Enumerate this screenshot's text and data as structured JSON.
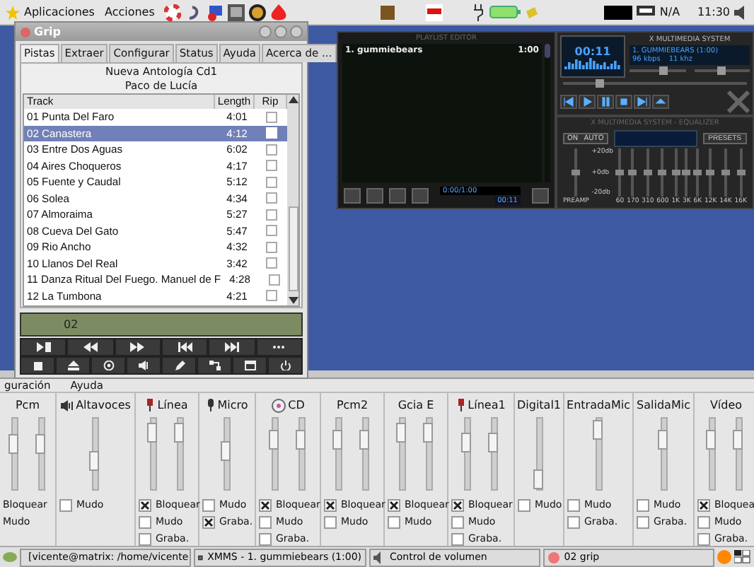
{
  "top_panel": {
    "menus": [
      "Aplicaciones",
      "Acciones"
    ],
    "status_text": "N/A",
    "clock": "11:30"
  },
  "grip": {
    "title": "Grip",
    "tabs": [
      {
        "label": "Pistas",
        "selected": true
      },
      {
        "label": "Extraer",
        "selected": false
      },
      {
        "label": "Configurar",
        "selected": false
      },
      {
        "label": "Status",
        "selected": false
      },
      {
        "label": "Ayuda",
        "selected": false
      },
      {
        "label": "Acerca de ...",
        "selected": false
      }
    ],
    "album": "Nueva Antología Cd1",
    "artist": "Paco de Lucía",
    "columns": [
      "Track",
      "Length",
      "Rip"
    ],
    "rows": [
      {
        "track": "01  Punta Del Faro",
        "length": "4:01",
        "rip": false,
        "selected": false
      },
      {
        "track": "02  Canastera",
        "length": "4:12",
        "rip": false,
        "selected": true
      },
      {
        "track": "03  Entre Dos Aguas",
        "length": "6:02",
        "rip": false,
        "selected": false
      },
      {
        "track": "04  Aires Choqueros",
        "length": "4:17",
        "rip": false,
        "selected": false
      },
      {
        "track": "05  Fuente y Caudal",
        "length": "5:12",
        "rip": false,
        "selected": false
      },
      {
        "track": "06  Solea",
        "length": "4:34",
        "rip": false,
        "selected": false
      },
      {
        "track": "07  Almoraima",
        "length": "5:27",
        "rip": false,
        "selected": false
      },
      {
        "track": "08  Cueva Del Gato",
        "length": "5:47",
        "rip": false,
        "selected": false
      },
      {
        "track": "09  Rio Ancho",
        "length": "4:32",
        "rip": false,
        "selected": false
      },
      {
        "track": "10  Llanos Del Real",
        "length": "3:42",
        "rip": false,
        "selected": false
      },
      {
        "track": "11  Danza Ritual Del Fuego. Manuel de F",
        "length": "4:28",
        "rip": false,
        "selected": false
      },
      {
        "track": "12  La Tumbona",
        "length": "4:21",
        "rip": false,
        "selected": false
      }
    ],
    "display": "02"
  },
  "xmms": {
    "playlist": {
      "title": "PLAYLIST EDITOR",
      "entries": [
        {
          "title": "1. gummiebears",
          "time": "1:00"
        }
      ],
      "time_display": "0:00/1:00",
      "counter": "00:11"
    },
    "player": {
      "title": "X MULTIMEDIA SYSTEM",
      "time": "00:11",
      "song": "1. GUMMIEBEARS (1:00)",
      "bitrate": "96 kbps",
      "rate": "11 khz",
      "volume": {
        "level": 0.6
      },
      "balance": {
        "level": 0.5
      },
      "seek": {
        "level": 0.2
      }
    },
    "equalizer": {
      "title": "X MULTIMEDIA SYSTEM - EQUALIZER",
      "on": "ON",
      "auto": "AUTO",
      "presets": "PRESETS",
      "scale": [
        "+20db",
        "+0db",
        "-20db"
      ],
      "preamp": {
        "label": "PREAMP",
        "level": 0.5
      },
      "bands": [
        {
          "label": "60",
          "level": 0.5
        },
        {
          "label": "170",
          "level": 0.5
        },
        {
          "label": "310",
          "level": 0.5
        },
        {
          "label": "600",
          "level": 0.5
        },
        {
          "label": "1K",
          "level": 0.5
        },
        {
          "label": "3K",
          "level": 0.5
        },
        {
          "label": "6K",
          "level": 0.5
        },
        {
          "label": "12K",
          "level": 0.5
        },
        {
          "label": "14K",
          "level": 0.5
        },
        {
          "label": "16K",
          "level": 0.5
        }
      ]
    }
  },
  "mixer": {
    "menus": [
      "guración",
      "Ayuda"
    ],
    "channels": [
      {
        "name": "Pcm",
        "kind": "plain",
        "sliders": [
          {
            "level": 0.65
          },
          {
            "level": 0.64
          }
        ],
        "options": [
          {
            "label": "Bloquear"
          },
          {
            "label": "Mudo"
          }
        ]
      },
      {
        "name": "Altavoces",
        "kind": "speaker",
        "sliders": [
          {
            "level": 0.4
          }
        ],
        "options": [
          {
            "label": "Mudo",
            "checked": false
          }
        ]
      },
      {
        "name": "Línea",
        "kind": "line",
        "sliders": [
          {
            "level": 0.8
          },
          {
            "level": 0.8
          }
        ],
        "options": [
          {
            "label": "Bloquear",
            "checked": true
          },
          {
            "label": "Mudo",
            "checked": false
          },
          {
            "label": "Graba.",
            "checked": false
          }
        ]
      },
      {
        "name": "Micro",
        "kind": "mic",
        "sliders": [
          {
            "level": 0.55
          }
        ],
        "options": [
          {
            "label": "Mudo",
            "checked": false
          },
          {
            "label": "Graba.",
            "checked": true
          }
        ]
      },
      {
        "name": "CD",
        "kind": "cd",
        "sliders": [
          {
            "level": 0.7
          },
          {
            "level": 0.7
          }
        ],
        "options": [
          {
            "label": "Bloquear",
            "checked": true
          },
          {
            "label": "Mudo",
            "checked": false
          },
          {
            "label": "Graba.",
            "checked": false
          }
        ]
      },
      {
        "name": "Pcm2",
        "kind": "plain",
        "sliders": [
          {
            "level": 0.7
          },
          {
            "level": 0.7
          }
        ],
        "options": [
          {
            "label": "Bloquear",
            "checked": true
          },
          {
            "label": "Mudo",
            "checked": false
          }
        ]
      },
      {
        "name": "Gcia E",
        "kind": "plain",
        "sliders": [
          {
            "level": 0.8
          },
          {
            "level": 0.8
          }
        ],
        "options": [
          {
            "label": "Bloquear",
            "checked": true
          },
          {
            "label": "Mudo",
            "checked": false
          }
        ]
      },
      {
        "name": "Línea1",
        "kind": "line",
        "sliders": [
          {
            "level": 0.67
          },
          {
            "level": 0.67
          }
        ],
        "options": [
          {
            "label": "Bloquear",
            "checked": true
          },
          {
            "label": "Mudo",
            "checked": false
          },
          {
            "label": "Graba.",
            "checked": false
          }
        ]
      },
      {
        "name": "Digital1",
        "kind": "plain",
        "sliders": [
          {
            "level": 0.15
          }
        ],
        "options": [
          {
            "label": "Mudo",
            "checked": false
          }
        ]
      },
      {
        "name": "EntradaMic",
        "kind": "plain",
        "sliders": [
          {
            "level": 0.85
          }
        ],
        "options": [
          {
            "label": "Mudo",
            "checked": false
          },
          {
            "label": "Graba.",
            "checked": false
          }
        ]
      },
      {
        "name": "SalidaMic",
        "kind": "plain",
        "sliders": [
          {
            "level": 0.7
          }
        ],
        "options": [
          {
            "label": "Mudo",
            "checked": false
          },
          {
            "label": "Graba.",
            "checked": false
          }
        ]
      },
      {
        "name": "Vídeo",
        "kind": "plain",
        "sliders": [
          {
            "level": 0.7
          },
          {
            "level": 0.7
          }
        ],
        "options": [
          {
            "label": "Bloquea",
            "checked": true
          },
          {
            "label": "Mudo",
            "checked": false
          },
          {
            "label": "Graba.",
            "checked": false
          }
        ]
      }
    ]
  },
  "taskbar": {
    "tasks": [
      {
        "label": "[vicente@matrix: /home/vicente",
        "kind": "terminal"
      },
      {
        "label": "XMMS - 1. gummiebears (1:00)",
        "kind": "xmms"
      },
      {
        "label": "Control de volumen",
        "kind": "volume"
      },
      {
        "label": "02  grip",
        "kind": "grip"
      }
    ]
  }
}
